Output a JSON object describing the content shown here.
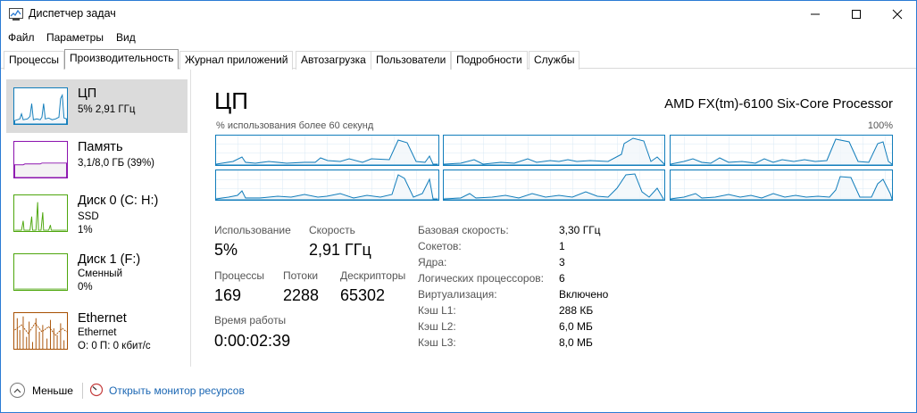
{
  "window": {
    "title": "Диспетчер задач"
  },
  "menu": [
    "Файл",
    "Параметры",
    "Вид"
  ],
  "tabs": [
    "Процессы",
    "Производительность",
    "Журнал приложений",
    "Автозагрузка",
    "Пользователи",
    "Подробности",
    "Службы"
  ],
  "active_tab": "Производительность",
  "sidebar": {
    "items": [
      {
        "name": "ЦП",
        "line1": "5% 2,91 ГГц",
        "line2": "",
        "color": "#117dbb",
        "fill": "#f1f6fa"
      },
      {
        "name": "Память",
        "line1": "3,1/8,0 ГБ (39%)",
        "line2": "",
        "color": "#8b12ae",
        "fill": "#f4f2f4"
      },
      {
        "name": "Диск 0 (C: H:)",
        "line1": "SSD",
        "line2": "1%",
        "color": "#4da60c",
        "fill": "#eff7e9"
      },
      {
        "name": "Диск 1 (F:)",
        "line1": "Сменный",
        "line2": "0%",
        "color": "#4da60c",
        "fill": "#eff7e9"
      },
      {
        "name": "Ethernet",
        "line1": "Ethernet",
        "line2": "О: 0 П: 0 кбит/с",
        "color": "#a74f01",
        "fill": "#fcf3eb"
      }
    ]
  },
  "main": {
    "title": "ЦП",
    "cpu_model": "AMD FX(tm)-6100 Six-Core Processor",
    "util_label": "% использования более 60 секунд",
    "max_label": "100%",
    "stats": {
      "usage_label": "Использование",
      "usage_value": "5%",
      "speed_label": "Скорость",
      "speed_value": "2,91 ГГц",
      "processes_label": "Процессы",
      "processes_value": "169",
      "threads_label": "Потоки",
      "threads_value": "2288",
      "handles_label": "Дескрипторы",
      "handles_value": "65302",
      "uptime_label": "Время работы",
      "uptime_value": "0:00:02:39"
    },
    "details": [
      {
        "label": "Базовая скорость:",
        "value": "3,30 ГГц"
      },
      {
        "label": "Сокетов:",
        "value": "1"
      },
      {
        "label": "Ядра:",
        "value": "3"
      },
      {
        "label": "Логических процессоров:",
        "value": "6"
      },
      {
        "label": "Виртуализация:",
        "value": "Включено"
      },
      {
        "label": "Кэш L1:",
        "value": "288 КБ"
      },
      {
        "label": "Кэш L2:",
        "value": "6,0 МБ"
      },
      {
        "label": "Кэш L3:",
        "value": "8,0 МБ"
      }
    ]
  },
  "bottom": {
    "fewer_details": "Меньше",
    "resource_monitor": "Открыть монитор ресурсов"
  }
}
